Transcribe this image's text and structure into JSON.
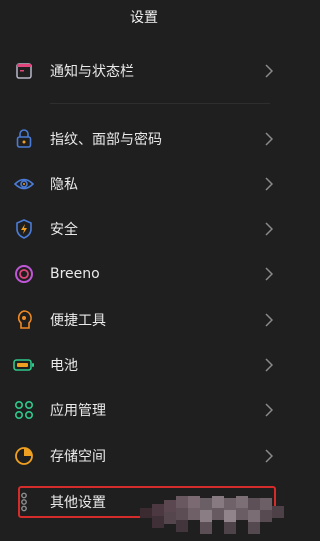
{
  "header": {
    "title": "设置"
  },
  "items": [
    {
      "label": "通知与状态栏",
      "icon": "notification-icon"
    },
    {
      "label": "指纹、面部与密码",
      "icon": "lock-icon"
    },
    {
      "label": "隐私",
      "icon": "privacy-eye-icon"
    },
    {
      "label": "安全",
      "icon": "shield-icon"
    },
    {
      "label": "Breeno",
      "icon": "breeno-icon"
    },
    {
      "label": "便捷工具",
      "icon": "tools-icon"
    },
    {
      "label": "电池",
      "icon": "battery-icon"
    },
    {
      "label": "应用管理",
      "icon": "apps-grid-icon"
    },
    {
      "label": "存储空间",
      "icon": "storage-icon"
    },
    {
      "label": "其他设置",
      "icon": "more-settings-icon"
    }
  ],
  "colors": {
    "background": "#1f1f1f",
    "highlight_border": "#d42b2b",
    "notification": "#e0457b",
    "lock": "#4a7bd6",
    "privacy": "#4a7bd6",
    "shield": "#4a7bd6",
    "breeno": "#c056d8",
    "tools": "#f08a24",
    "battery": "#2ec98b",
    "apps": "#2ec98b",
    "storage": "#f0a020",
    "more": "#8e8e8e"
  }
}
